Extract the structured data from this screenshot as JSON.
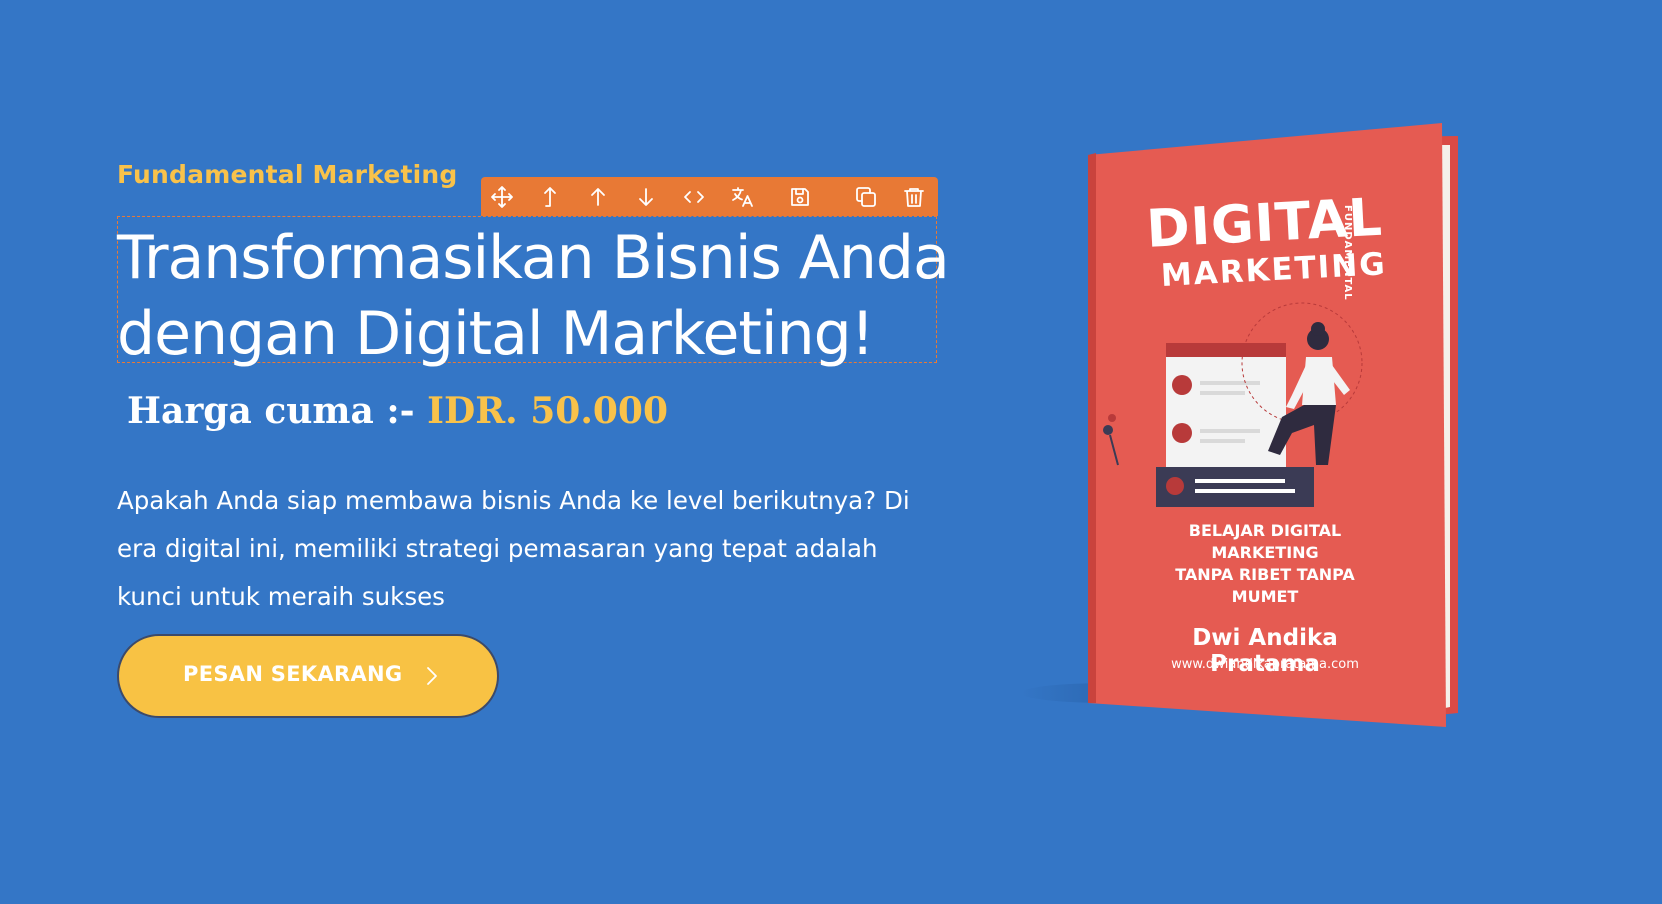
{
  "hero": {
    "eyebrow": "Fundamental Marketing",
    "headline_line1": "Transformasikan Bisnis Anda",
    "headline_line2": "dengan Digital Marketing!",
    "price_label": "Harga cuma :-",
    "price_value": "IDR. 50.000",
    "description": "Apakah Anda siap membawa bisnis Anda ke level berikutnya? Di era digital ini, memiliki strategi pemasaran yang tepat adalah kunci untuk meraih sukses",
    "cta_label": "PESAN SEKARANG"
  },
  "editor_toolbar": {
    "background": "#e87935",
    "tools": [
      {
        "name": "move",
        "icon": "move-icon"
      },
      {
        "name": "select-parent",
        "icon": "arrow-up-corner-icon"
      },
      {
        "name": "move-up",
        "icon": "arrow-up-icon"
      },
      {
        "name": "move-down",
        "icon": "arrow-down-icon"
      },
      {
        "name": "edit-code",
        "icon": "code-icon"
      },
      {
        "name": "translate",
        "icon": "translate-icon"
      },
      {
        "name": "save",
        "icon": "save-icon"
      },
      {
        "name": "duplicate",
        "icon": "copy-icon"
      },
      {
        "name": "delete",
        "icon": "trash-icon"
      }
    ]
  },
  "book": {
    "title_line1": "DIGITAL",
    "title_line2": "MARKETING",
    "vertical_label": "FUNDAMENTAL",
    "tagline_line1": "BELAJAR DIGITAL MARKETING",
    "tagline_line2": "TANPA RIBET TANPA MUMET",
    "author": "Dwi Andika Pratama",
    "url": "www.dwiandikapratama.com",
    "cover_color": "#e55b52"
  },
  "colors": {
    "background": "#3476c6",
    "accent_yellow": "#f9c24a",
    "text": "#ffffff"
  }
}
